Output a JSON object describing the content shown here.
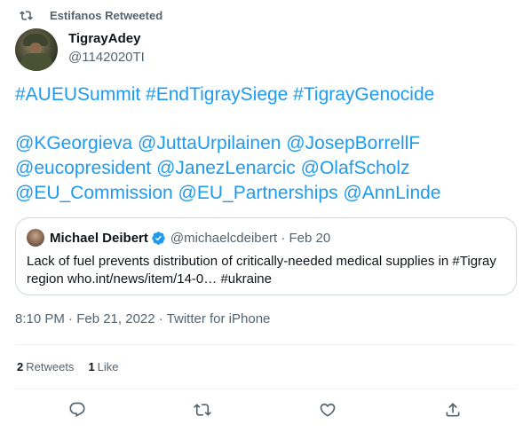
{
  "retweet_banner": {
    "text": "Estifanos Retweeted",
    "icon": "retweet-icon"
  },
  "author": {
    "display_name": "TigrayAdey",
    "handle": "@1142020TI"
  },
  "tweet": {
    "lines": [
      "#AUEUSummit #EndTigraySiege #TigrayGenocide",
      "@KGeorgieva @JuttaUrpilainen @JosepBorrellF",
      "@eucopresident @JanezLenarcic @OlafScholz",
      "@EU_Commission @EU_Partnerships @AnnLinde"
    ]
  },
  "quote": {
    "name": "Michael Deibert",
    "handle_date": "@michaelcdeibert · Feb 20",
    "text_line1": "Lack of fuel prevents distribution of critically-needed medical supplies in #Tigray",
    "text_line2": "region who.int/news/item/14-0… #ukraine"
  },
  "meta": "8:10 PM · Feb 21, 2022 · Twitter for iPhone",
  "stats": {
    "retweets_count": "2",
    "retweets_label": "Retweets",
    "likes_count": "1",
    "likes_label": "Like"
  },
  "actions": [
    "reply-icon",
    "retweet-icon",
    "like-icon",
    "share-icon"
  ],
  "colors": {
    "link": "#1d9bf0",
    "text": "#0f1419",
    "muted": "#536471",
    "border": "#cfd9de",
    "divider": "#eff3f4"
  }
}
